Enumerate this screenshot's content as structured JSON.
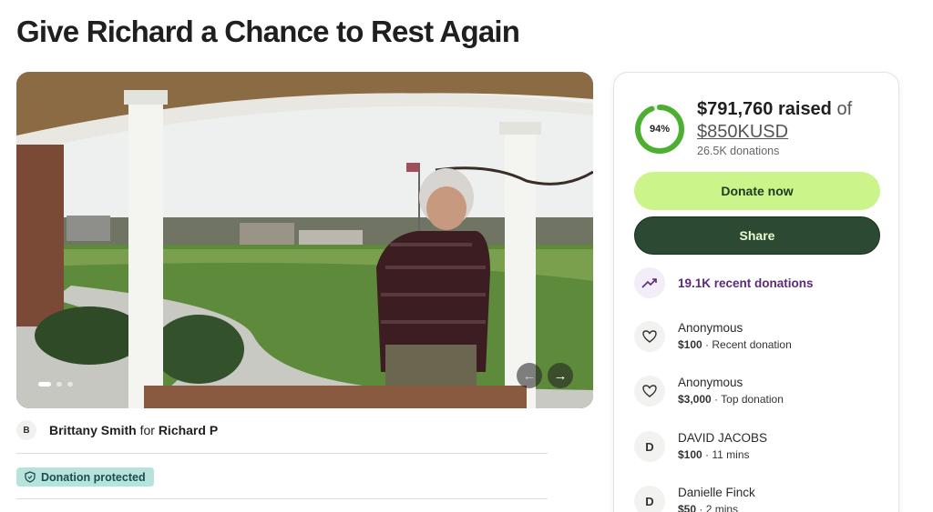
{
  "page": {
    "title": "Give Richard a Chance to Rest Again"
  },
  "media": {
    "active_slide": 1,
    "slide_count": 3,
    "prev_icon": "←",
    "next_icon": "→"
  },
  "organizer": {
    "avatar_initial": "B",
    "name": "Brittany Smith",
    "for_text": "for",
    "beneficiary": "Richard P"
  },
  "badge": {
    "label": "Donation protected"
  },
  "donation": {
    "percent_label": "94%",
    "progress_fraction": 0.94,
    "raised": "$791,760 raised",
    "of_text": "of",
    "goal": "$850KUSD",
    "donations_count": "26.5K donations",
    "donate_label": "Donate now",
    "share_label": "Share",
    "recent_label": "19.1K recent donations",
    "donors": [
      {
        "avatar": "heart",
        "name": "Anonymous",
        "amount": "$100",
        "note": " · Recent donation"
      },
      {
        "avatar": "heart",
        "name": "Anonymous",
        "amount": "$3,000",
        "note": " · Top donation"
      },
      {
        "avatar": "D",
        "name": "DAVID JACOBS",
        "amount": "$100",
        "note": " · 11 mins"
      },
      {
        "avatar": "D",
        "name": "Danielle Finck",
        "amount": "$50",
        "note": " · 2 mins"
      }
    ]
  },
  "colors": {
    "ring": "#4caf2f",
    "donate_bg": "#cbf48a",
    "share_bg": "#2c4a33",
    "recent_text": "#5b2a7a",
    "badge_bg": "#b7e3dd"
  }
}
